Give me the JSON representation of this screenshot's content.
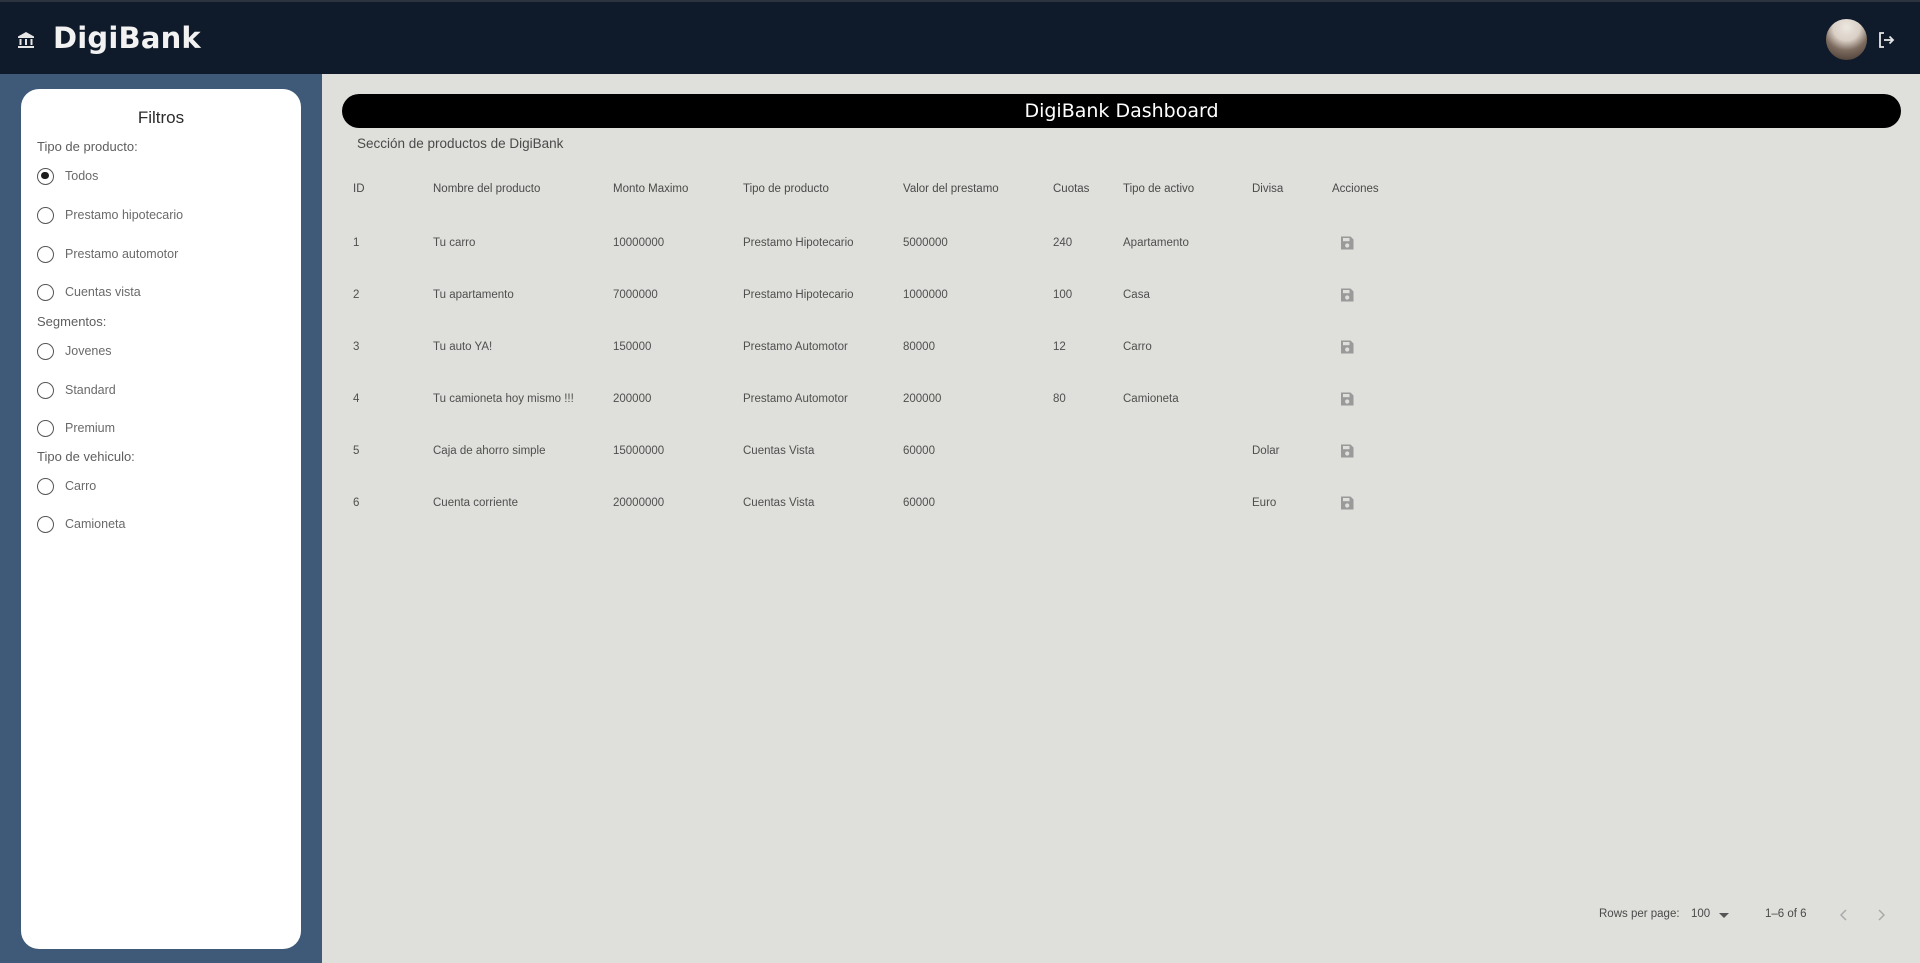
{
  "header": {
    "brand": "DigiBank",
    "icons": {
      "bank": "bank-icon",
      "logout": "logout-icon",
      "avatar": "user-avatar"
    }
  },
  "filters": {
    "title": "Filtros",
    "groups": [
      {
        "label": "Tipo de producto:",
        "options": [
          "Todos",
          "Prestamo hipotecario",
          "Prestamo automotor",
          "Cuentas vista"
        ],
        "selected": "Todos"
      },
      {
        "label": "Segmentos:",
        "options": [
          "Jovenes",
          "Standard",
          "Premium"
        ],
        "selected": ""
      },
      {
        "label": "Tipo de vehiculo:",
        "options": [
          "Carro",
          "Camioneta"
        ],
        "selected": ""
      }
    ]
  },
  "main": {
    "dashboard_title": "DigiBank Dashboard",
    "section_title": "Sección de productos de DigiBank",
    "columns": [
      "ID",
      "Nombre del producto",
      "Monto Maximo",
      "Tipo de producto",
      "Valor del prestamo",
      "Cuotas",
      "Tipo de activo",
      "Divisa",
      "Acciones"
    ],
    "rows": [
      {
        "id": "1",
        "nombre": "Tu carro",
        "monto": "10000000",
        "tipo": "Prestamo Hipotecario",
        "valor": "5000000",
        "cuotas": "240",
        "activo": "Apartamento",
        "divisa": ""
      },
      {
        "id": "2",
        "nombre": "Tu apartamento",
        "monto": "7000000",
        "tipo": "Prestamo Hipotecario",
        "valor": "1000000",
        "cuotas": "100",
        "activo": "Casa",
        "divisa": ""
      },
      {
        "id": "3",
        "nombre": "Tu auto YA!",
        "monto": "150000",
        "tipo": "Prestamo Automotor",
        "valor": "80000",
        "cuotas": "12",
        "activo": "Carro",
        "divisa": ""
      },
      {
        "id": "4",
        "nombre": "Tu camioneta hoy mismo !!!",
        "monto": "200000",
        "tipo": "Prestamo Automotor",
        "valor": "200000",
        "cuotas": "80",
        "activo": "Camioneta",
        "divisa": ""
      },
      {
        "id": "5",
        "nombre": "Caja de ahorro simple",
        "monto": "15000000",
        "tipo": "Cuentas Vista",
        "valor": "60000",
        "cuotas": "",
        "activo": "",
        "divisa": "Dolar"
      },
      {
        "id": "6",
        "nombre": "Cuenta corriente",
        "monto": "20000000",
        "tipo": "Cuentas Vista",
        "valor": "60000",
        "cuotas": "",
        "activo": "",
        "divisa": "Euro"
      }
    ],
    "action_icon": "save-icon",
    "footer": {
      "rows_per_page_label": "Rows per page:",
      "rows_per_page_value": "100",
      "range": "1–6 of 6"
    }
  },
  "colors": {
    "topbar": "#0f1b2b",
    "sidebar": "#3f5a78",
    "main_bg": "#dfdfdb",
    "dash_bar": "#000000"
  }
}
